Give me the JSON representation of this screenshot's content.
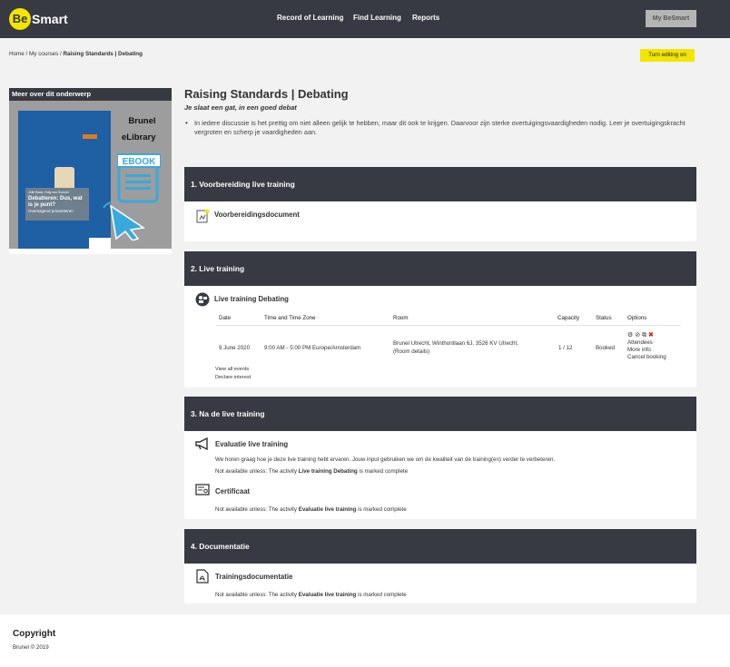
{
  "header": {
    "logo_be": "Be",
    "logo_smart": "Smart",
    "nav": [
      "Record of Learning",
      "Find Learning",
      "Reports"
    ],
    "my_button": "My BeSmart"
  },
  "breadcrumb": {
    "home": "Home /",
    "courses": "My courses /",
    "current": "Raising Standards | Debating"
  },
  "edit_button": "Turn editing on",
  "sidebar": {
    "title": "Meer over dit onderwerp",
    "brand1": "Brunel",
    "brand2": "eLibrary",
    "ebook": "EBOOK",
    "authors": "Jelle Baas, Huig van Roesler",
    "book_title": "Debatteren: Dus, wat is je punt?",
    "book_subtitle": "Overtuigend presenteren"
  },
  "course": {
    "title": "Raising Standards | Debating",
    "subtitle": "Je slaat een gat, in een goed debat",
    "intro": "In iedere discussie is het prettig om niet alleen gelijk te hebben, maar dit ook te krijgen. Daarvoor zijn sterke overtuigingsvaardigheden nodig. Leer je overtuigingskracht vergroten en scherp je vaardigheden aan."
  },
  "sections": [
    {
      "title": "1. Voorbereiding live training",
      "activity": "Voorbereidingsdocument"
    },
    {
      "title": "2. Live training",
      "activity": "Live training Debating",
      "table": {
        "headers": [
          "Date",
          "Time and Time Zone",
          "Room",
          "Capacity",
          "Status",
          "Options"
        ],
        "row": {
          "date": "9 June 2020",
          "time": "9:00 AM - 5:00 PM Europe/Amsterdam",
          "room1": "Brunel Utrecht, Winthontlaan 6J, 3526 KV Utrecht,",
          "room2": "(Room details)",
          "capacity": "1 / 12",
          "status": "Booked",
          "options": [
            "Attendees",
            "More info",
            "Cancel booking"
          ]
        }
      },
      "links": [
        "View all events",
        "Declare interest"
      ]
    },
    {
      "title": "3. Na de live training",
      "activity1": "Evaluatie live training",
      "desc": "We horen graag hoe je deze live training hebt ervaren. Jouw input gebruiken we om de kwaliteit van de training(en) verder te verbeteren.",
      "restrict1_pre": "Not available unless: The activity ",
      "restrict1_act": "Live training Debating",
      "restrict1_post": " is marked complete",
      "activity2": "Certificaat",
      "restrict2_pre": "Not available unless: The activity ",
      "restrict2_act": "Evaluatie live training",
      "restrict2_post": " is marked complete"
    },
    {
      "title": "4. Documentatie",
      "activity": "Trainingsdocumentatie",
      "restrict_pre": "Not available unless: The activity ",
      "restrict_act": "Evaluatie live training",
      "restrict_post": " is marked complete"
    }
  ],
  "footer": {
    "heading": "Copyright",
    "text": "Brunel © 2019"
  }
}
